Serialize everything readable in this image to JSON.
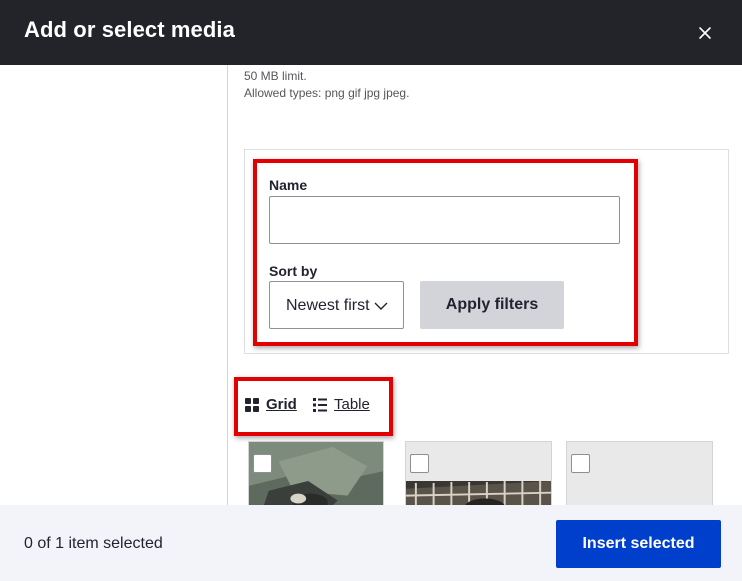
{
  "dialog": {
    "title": "Add or select media",
    "close_icon": "close-icon"
  },
  "upload": {
    "size_limit": "50 MB limit.",
    "allowed_types": "Allowed types: png gif jpg jpeg."
  },
  "filters": {
    "name_label": "Name",
    "name_value": "",
    "sort_label": "Sort by",
    "sort_value": "Newest first",
    "apply_label": "Apply filters"
  },
  "views": {
    "grid_label": "Grid",
    "grid_icon": "grid-icon",
    "table_label": "Table",
    "table_icon": "list-icon",
    "active": "Grid"
  },
  "media_items": [
    {
      "checked": false,
      "thumbnail": "photo"
    },
    {
      "checked": false,
      "thumbnail": "photo"
    },
    {
      "checked": false,
      "thumbnail": "placeholder"
    }
  ],
  "footer": {
    "selection_text": "0 of 1 item selected",
    "insert_label": "Insert selected"
  },
  "colors": {
    "titlebar": "#232429",
    "primary_button": "#003ecc",
    "highlight": "#e30000",
    "footer_bg": "#f3f4f9"
  }
}
